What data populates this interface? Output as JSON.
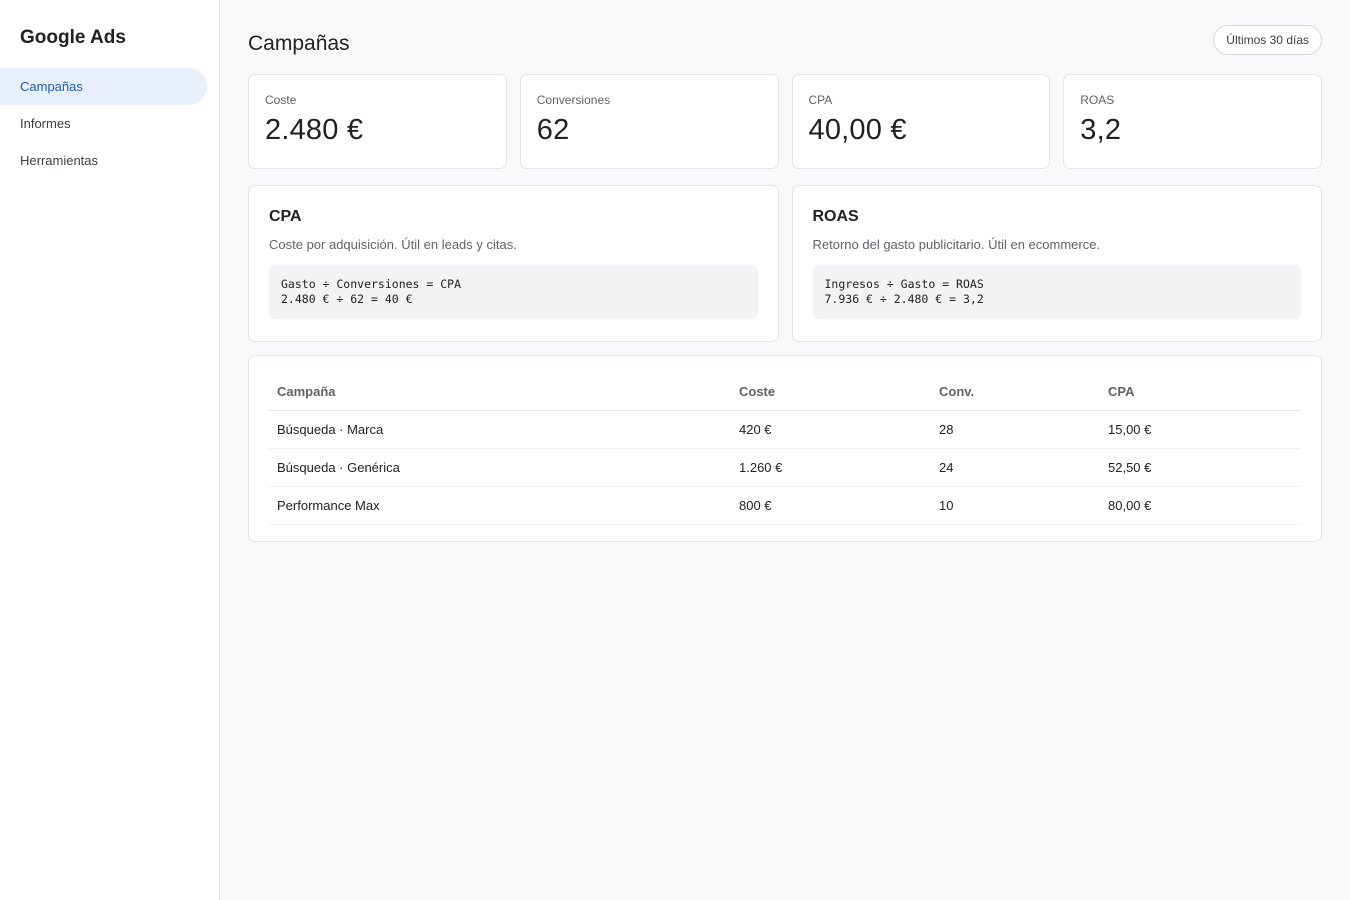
{
  "sidebar": {
    "brand": "Google Ads",
    "items": [
      {
        "label": "Campañas",
        "active": true
      },
      {
        "label": "Informes",
        "active": false
      },
      {
        "label": "Herramientas",
        "active": false
      }
    ]
  },
  "header": {
    "title": "Campañas",
    "date_range": "Últimos 30 días"
  },
  "kpis": [
    {
      "label": "Coste",
      "value": "2.480 €"
    },
    {
      "label": "Conversiones",
      "value": "62"
    },
    {
      "label": "CPA",
      "value": "40,00 €"
    },
    {
      "label": "ROAS",
      "value": "3,2"
    }
  ],
  "explainers": [
    {
      "title": "CPA",
      "description": "Coste por adquisición. Útil en leads y citas.",
      "formula_line1": "Gasto ÷ Conversiones = CPA",
      "formula_line2": "2.480 € ÷ 62 = 40 €"
    },
    {
      "title": "ROAS",
      "description": "Retorno del gasto publicitario. Útil en ecommerce.",
      "formula_line1": "Ingresos ÷ Gasto = ROAS",
      "formula_line2": "7.936 € ÷ 2.480 € = 3,2"
    }
  ],
  "table": {
    "headers": [
      "Campaña",
      "Coste",
      "Conv.",
      "CPA"
    ],
    "rows": [
      [
        "Búsqueda · Marca",
        "420 €",
        "28",
        "15,00 €"
      ],
      [
        "Búsqueda · Genérica",
        "1.260 €",
        "24",
        "52,50 €"
      ],
      [
        "Performance Max",
        "800 €",
        "10",
        "80,00 €"
      ]
    ]
  },
  "colors": {
    "accent": "#1a5fb4",
    "active_bg": "#e8f0fe",
    "background": "#f8f9fa"
  }
}
